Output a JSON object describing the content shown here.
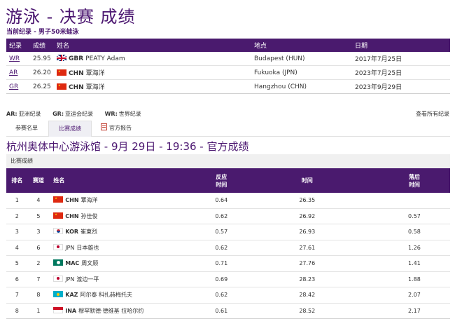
{
  "page": {
    "title": "游泳 - 决赛 成绩",
    "current_record_label": "当前纪录 - 男子50米蛙泳"
  },
  "records": {
    "headers": [
      "纪录",
      "成绩",
      "姓名",
      "地点",
      "日期"
    ],
    "rows": [
      {
        "code": "WR",
        "time": "25.95",
        "noc": "GBR",
        "name": "PEATY Adam",
        "flag": "gbr",
        "place": "Budapest (HUN)",
        "date": "2017年7月25日"
      },
      {
        "code": "AR",
        "time": "26.20",
        "noc": "CHN",
        "name": "覃海洋",
        "flag": "chn",
        "place": "Fukuoka (JPN)",
        "date": "2023年7月25日"
      },
      {
        "code": "GR",
        "time": "26.25",
        "noc": "CHN",
        "name": "覃海洋",
        "flag": "chn",
        "place": "Hangzhou (CHN)",
        "date": "2023年9月29日"
      }
    ]
  },
  "legend": {
    "ar_code": "AR:",
    "ar_text": "亚洲纪录",
    "gr_code": "GR:",
    "gr_text": "亚运会纪录",
    "wr_code": "WR:",
    "wr_text": "世界纪录",
    "view_all": "查看所有纪录"
  },
  "tabs": {
    "entries": "参赛名单",
    "results": "比赛成绩",
    "report": "官方报告"
  },
  "session": {
    "title": "杭州奥体中心游泳馆 - 9月 29日 - 19:36 - 官方成绩",
    "results_label": "比赛成绩"
  },
  "results": {
    "headers": {
      "rank": "排名",
      "lane": "赛道",
      "name": "姓名",
      "rt_line1": "反应",
      "rt_line2": "时间",
      "time": "时间",
      "behind_line1": "落后",
      "behind_line2": "时间"
    },
    "rows": [
      {
        "rank": "1",
        "lane": "4",
        "noc": "CHN",
        "name": "覃海洋",
        "flag": "chn",
        "rt": "0.64",
        "time": "26.35",
        "behind": ""
      },
      {
        "rank": "2",
        "lane": "5",
        "noc": "CHN",
        "name": "孙佳俊",
        "flag": "chn",
        "rt": "0.62",
        "time": "26.92",
        "behind": "0.57"
      },
      {
        "rank": "3",
        "lane": "3",
        "noc": "KOR",
        "name": "崔東烈",
        "flag": "kor",
        "rt": "0.57",
        "time": "26.93",
        "behind": "0.58"
      },
      {
        "rank": "4",
        "lane": "6",
        "noc": "JPN",
        "name": "日本雄也",
        "flag": "jpn",
        "rt": "0.62",
        "time": "27.61",
        "behind": "1.26"
      },
      {
        "rank": "5",
        "lane": "2",
        "noc": "MAC",
        "name": "周文顾",
        "flag": "mac",
        "rt": "0.71",
        "time": "27.76",
        "behind": "1.41"
      },
      {
        "rank": "6",
        "lane": "7",
        "noc": "JPN",
        "name": "渡边一平",
        "flag": "jpn",
        "rt": "0.69",
        "time": "28.23",
        "behind": "1.88"
      },
      {
        "rank": "7",
        "lane": "8",
        "noc": "KAZ",
        "name": "阿尔泰 科扎赫梅托夫",
        "flag": "kaz",
        "rt": "0.62",
        "time": "28.42",
        "behind": "2.07"
      },
      {
        "rank": "8",
        "lane": "1",
        "noc": "INA",
        "name": "穆罕默德·德维基 拉哈尔约",
        "flag": "ina",
        "rt": "0.61",
        "time": "28.52",
        "behind": "2.17"
      }
    ]
  },
  "colors": {
    "header_purple": "#4a1a6e",
    "title_purple": "#4b1670"
  }
}
